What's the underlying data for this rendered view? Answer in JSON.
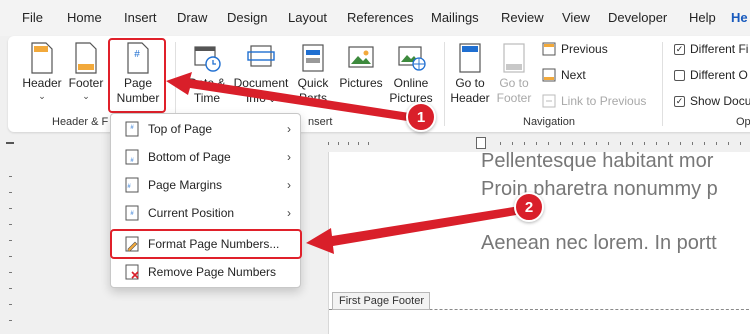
{
  "menubar": {
    "tabs": [
      {
        "label": "File"
      },
      {
        "label": "Home"
      },
      {
        "label": "Insert"
      },
      {
        "label": "Draw"
      },
      {
        "label": "Design"
      },
      {
        "label": "Layout"
      },
      {
        "label": "References"
      },
      {
        "label": "Mailings"
      },
      {
        "label": "Review"
      },
      {
        "label": "View"
      },
      {
        "label": "Developer"
      },
      {
        "label": "Help"
      },
      {
        "label": "He"
      }
    ],
    "active_tab": "He",
    "active_color": "#185abd"
  },
  "ribbon": {
    "header_footer_group": {
      "header_label": "Header",
      "footer_label": "Footer",
      "page_number_line1": "Page",
      "page_number_line2": "Number",
      "group_label": "Header & F"
    },
    "insert_group": {
      "date_time_line1": "Date &",
      "date_time_line2": "Time",
      "document_info_line1": "Document",
      "document_info_line2": "Info",
      "quick_parts_line1": "Quick",
      "quick_parts_line2": "Parts",
      "pictures_label": "Pictures",
      "online_pictures_line1": "Online",
      "online_pictures_line2": "Pictures",
      "group_label": "nsert"
    },
    "navigation_group": {
      "goto_header_line1": "Go to",
      "goto_header_line2": "Header",
      "goto_footer_line1": "Go to",
      "goto_footer_line2": "Footer",
      "previous_label": "Previous",
      "next_label": "Next",
      "link_to_previous_label": "Link to Previous",
      "group_label": "Navigation"
    },
    "options_group": {
      "different_first_label": "Different Fi",
      "different_odd_label": "Different O",
      "show_document_label": "Show Docu",
      "different_first_checked": true,
      "different_odd_checked": false,
      "show_document_checked": true,
      "group_label": "Op"
    }
  },
  "dropdown": {
    "items": [
      {
        "label": "Top of Page",
        "has_submenu": true,
        "icon": "page-top-icon"
      },
      {
        "label": "Bottom of Page",
        "has_submenu": true,
        "icon": "page-bottom-icon"
      },
      {
        "label": "Page Margins",
        "has_submenu": true,
        "icon": "page-margins-icon"
      },
      {
        "label": "Current Position",
        "has_submenu": true,
        "icon": "current-position-icon"
      },
      {
        "label": "Format Page Numbers...",
        "has_submenu": false,
        "icon": "format-page-numbers-icon"
      },
      {
        "label": "Remove Page Numbers",
        "has_submenu": false,
        "icon": "remove-page-numbers-icon"
      }
    ],
    "submenu_arrow": "›"
  },
  "document": {
    "lines": [
      "Pellentesque habitant mor",
      "Proin pharetra nonummy p",
      "Aenean nec lorem. In portt"
    ],
    "footer_tag": "First Page Footer"
  },
  "callouts": {
    "badge1": "1",
    "badge2": "2",
    "color": "#d91f2a"
  }
}
